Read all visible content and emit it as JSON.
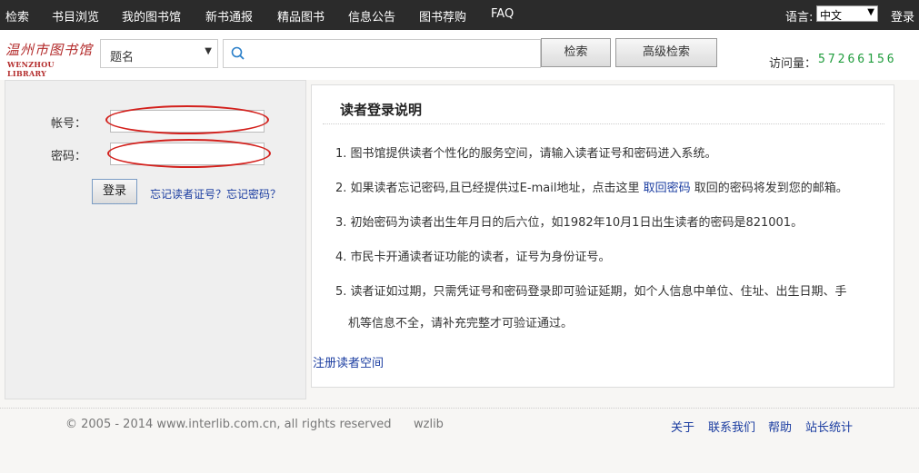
{
  "nav": {
    "items": [
      "检索",
      "书目浏览",
      "我的图书馆",
      "新书通报",
      "精品图书",
      "信息公告",
      "图书荐购",
      "FAQ"
    ],
    "language_label": "语言:",
    "language_value": "中文",
    "login": "登录"
  },
  "header": {
    "logo_cn": "温州市图书馆",
    "logo_en": "WENZHOU LIBRARY",
    "search_type": "题名",
    "search_value": "",
    "search_button": "检索",
    "advanced_button": "高级检索",
    "visit_label": "访问量：",
    "visit_count": "57266156"
  },
  "login": {
    "account_label": "帐号：",
    "account_value": "",
    "password_label": "密码：",
    "password_value": "",
    "login_button": "登录",
    "forgot_link": "忘记读者证号？忘记密码？"
  },
  "info": {
    "title": "读者登录说明",
    "items": [
      {
        "num": "1.",
        "text": "图书馆提供读者个性化的服务空间，请输入读者证号和密码进入系统。"
      },
      {
        "num": "2.",
        "before": "如果读者忘记密码,且已经提供过E-mail地址，点击这里 ",
        "link": "取回密码",
        "after": " 取回的密码将发到您的邮箱。"
      },
      {
        "num": "3.",
        "text": "初始密码为读者出生年月日的后六位，如1982年10月1日出生读者的密码是821001。"
      },
      {
        "num": "4.",
        "text": "市民卡开通读者证功能的读者，证号为身份证号。"
      },
      {
        "num": "5.",
        "text": "读者证如过期，只需凭证号和密码登录即可验证延期，如个人信息中单位、住址、出生日期、手",
        "text2": "机等信息不全，请补充完整才可验证通过。"
      }
    ],
    "register_link": "注册读者空间"
  },
  "footer": {
    "copyright": "© 2005 - 2014 www.interlib.com.cn, all rights reserved",
    "site": "wzlib",
    "links": [
      "关于",
      "联系我们",
      "帮助",
      "站长统计"
    ]
  },
  "colors": {
    "nav_bg": "#2b2b2b",
    "link": "#1a3ca0",
    "visit_count": "#1f9c3c",
    "highlight_ellipse": "#d3201c",
    "logo": "#b32b2b"
  },
  "icons": [
    "search-icon",
    "chevron-down-icon"
  ]
}
